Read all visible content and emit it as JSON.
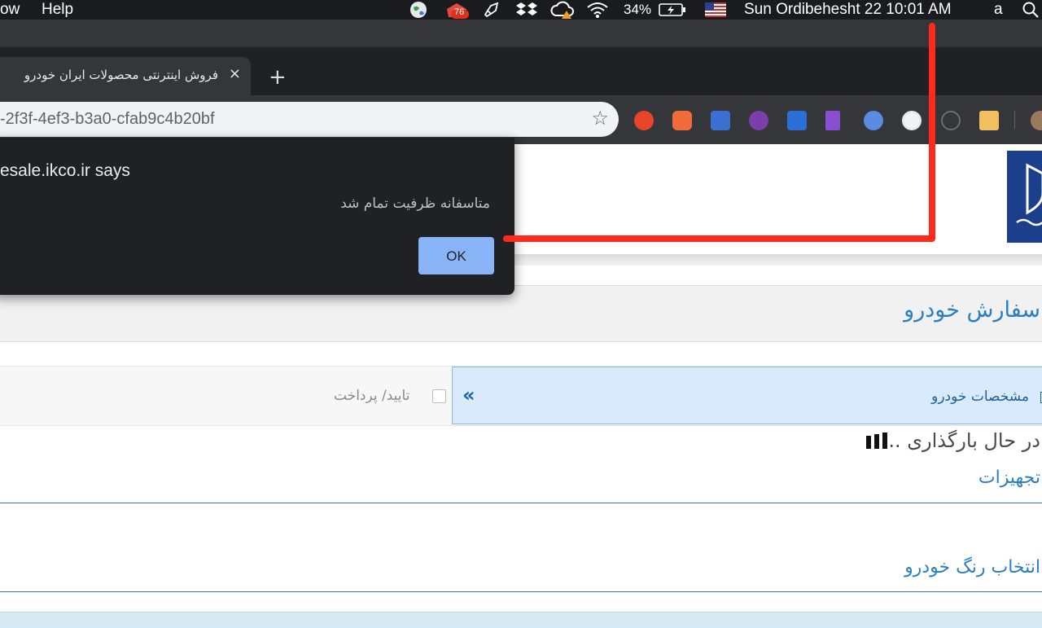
{
  "menubar": {
    "menus": [
      "ow",
      "Help"
    ],
    "battery": "34%",
    "clock": "Sun Ordibehesht 22  10:01 AM",
    "input_source": "a",
    "badge_count": "76"
  },
  "browser": {
    "tab_title": "فروش اینترنتی محصولات ایران خودرو",
    "tab_close": "×",
    "new_tab": "+",
    "url": "-2f3f-4ef3-b3a0-cfab9c4b20bf",
    "star": "☆"
  },
  "dialog": {
    "origin": "esale.ikco.ir says",
    "message": "متاسفانه ظرفیت تمام شد",
    "ok_label": "OK"
  },
  "page": {
    "title": "سفارش خودرو",
    "steps": [
      {
        "label": "مشخصات خودرو",
        "active": true
      },
      {
        "label": "تایید/ پرداخت",
        "active": false
      }
    ],
    "step_arrows": "«",
    "loading_text": "در حال بارگذاری ...",
    "sections": [
      "تجهیزات",
      "انتخاب رنگ خودرو"
    ]
  },
  "colors": {
    "accent": "#2a7fc1",
    "annotation": "#ff2a1a",
    "dialog_button": "#8ab4f8"
  }
}
